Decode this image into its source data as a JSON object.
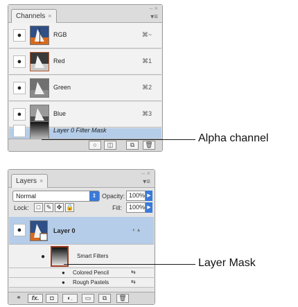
{
  "channels_panel": {
    "tab_label": "Channels",
    "tab_close": "×",
    "window_controls": "– ×",
    "menu_button": "▾≡",
    "rows": [
      {
        "name": "RGB",
        "shortcut": "⌘~",
        "visible": true
      },
      {
        "name": "Red",
        "shortcut": "⌘1",
        "visible": true
      },
      {
        "name": "Green",
        "shortcut": "⌘2",
        "visible": true
      },
      {
        "name": "Blue",
        "shortcut": "⌘3",
        "visible": true
      },
      {
        "name": "Layer 0 Filter Mask",
        "shortcut": "",
        "visible": false
      }
    ],
    "bottom_buttons": [
      "○",
      "◫",
      "⧉",
      "🗑"
    ]
  },
  "layers_panel": {
    "tab_label": "Layers",
    "tab_close": "×",
    "window_controls": "– ×",
    "menu_button": "▾≡",
    "blend_mode": "Normal",
    "opacity_label": "Opacity:",
    "opacity_value": "100%",
    "lock_label": "Lock:",
    "lock_icons": [
      "□",
      "✎",
      "✥",
      "🔒"
    ],
    "fill_label": "Fill:",
    "fill_value": "100%",
    "layer_name": "Layer 0",
    "smart_filters_label": "Smart Filters",
    "filters": [
      "Colored Pencil",
      "Rough Pastels"
    ],
    "bottom_buttons": [
      "⚭",
      "fx.",
      "◘",
      "◐.",
      "▭",
      "⧉",
      "🗑"
    ]
  },
  "callouts": {
    "alpha": "Alpha channel",
    "mask": "Layer Mask"
  },
  "colors": {
    "selection": "#b5cde9",
    "accent_blue": "#3b7ad6",
    "callout_line": "#1a1a1a"
  }
}
